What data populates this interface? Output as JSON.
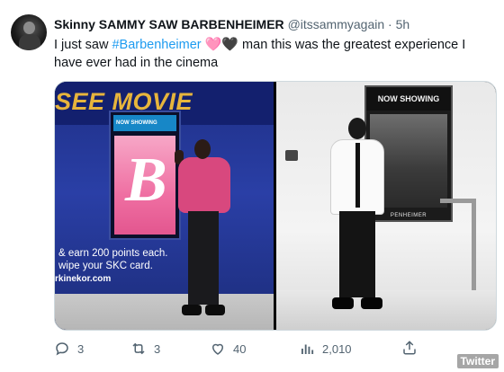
{
  "tweet": {
    "display_name": "Skinny SAMMY SAW BARBENHEIMER",
    "handle": "@itssammyagain",
    "separator": "·",
    "time": "5h",
    "text_before": "I just saw ",
    "hashtag": "#Barbenheimer",
    "emoji_1": "🩷",
    "emoji_2": "🖤",
    "text_after": " man this was the greatest experience I have ever had in the cinema"
  },
  "media": {
    "left_photo": {
      "sign": "SEE MOVIE",
      "kiosk_banner": "NOW SHOWING",
      "poster_letter": "B",
      "promo_line_1": "& earn 200 points each.",
      "promo_line_2": "wipe your SKC card.",
      "promo_url": "rkinekor.com"
    },
    "right_photo": {
      "banner": "NOW SHOWING",
      "poster_title": "PENHEIMER"
    }
  },
  "actions": {
    "replies": "3",
    "retweets": "3",
    "likes": "40",
    "views": "2,010"
  },
  "icons": {
    "reply": "reply-icon",
    "retweet": "retweet-icon",
    "like": "heart-icon",
    "views": "views-icon",
    "share": "share-icon"
  },
  "watermark": "Twitter",
  "colors": {
    "hashtag": "#1d9bf0",
    "muted": "#536471",
    "text": "#0f1419"
  }
}
